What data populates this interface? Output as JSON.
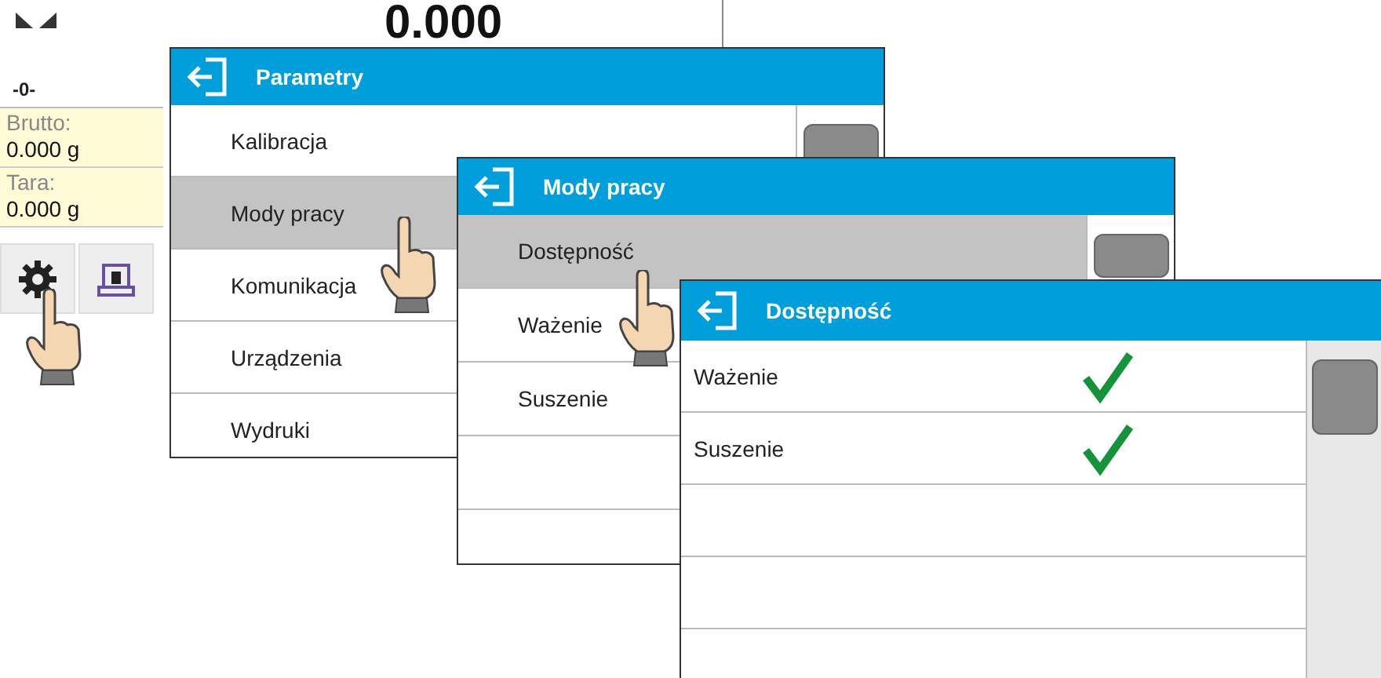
{
  "base_screen": {
    "zero_indicator": "-0-",
    "display": "0.000",
    "info": [
      {
        "label": "Brutto:",
        "value": "0.000 g"
      },
      {
        "label": "Tara:",
        "value": "0.000 g"
      }
    ]
  },
  "windows": [
    {
      "title": "Parametry",
      "items": [
        {
          "label": "Kalibracja",
          "selected": false
        },
        {
          "label": "Mody pracy",
          "selected": true
        },
        {
          "label": "Komunikacja",
          "selected": false
        },
        {
          "label": "Urządzenia",
          "selected": false
        },
        {
          "label": "Wydruki",
          "selected": false
        }
      ]
    },
    {
      "title": "Mody pracy",
      "items": [
        {
          "label": "Dostępność",
          "selected": true
        },
        {
          "label": "Ważenie",
          "selected": false
        },
        {
          "label": "Suszenie",
          "selected": false
        }
      ]
    },
    {
      "title": "Dostępność",
      "items": [
        {
          "label": "Ważenie",
          "selected": false,
          "checked": true
        },
        {
          "label": "Suszenie",
          "selected": false,
          "checked": true
        }
      ]
    }
  ]
}
